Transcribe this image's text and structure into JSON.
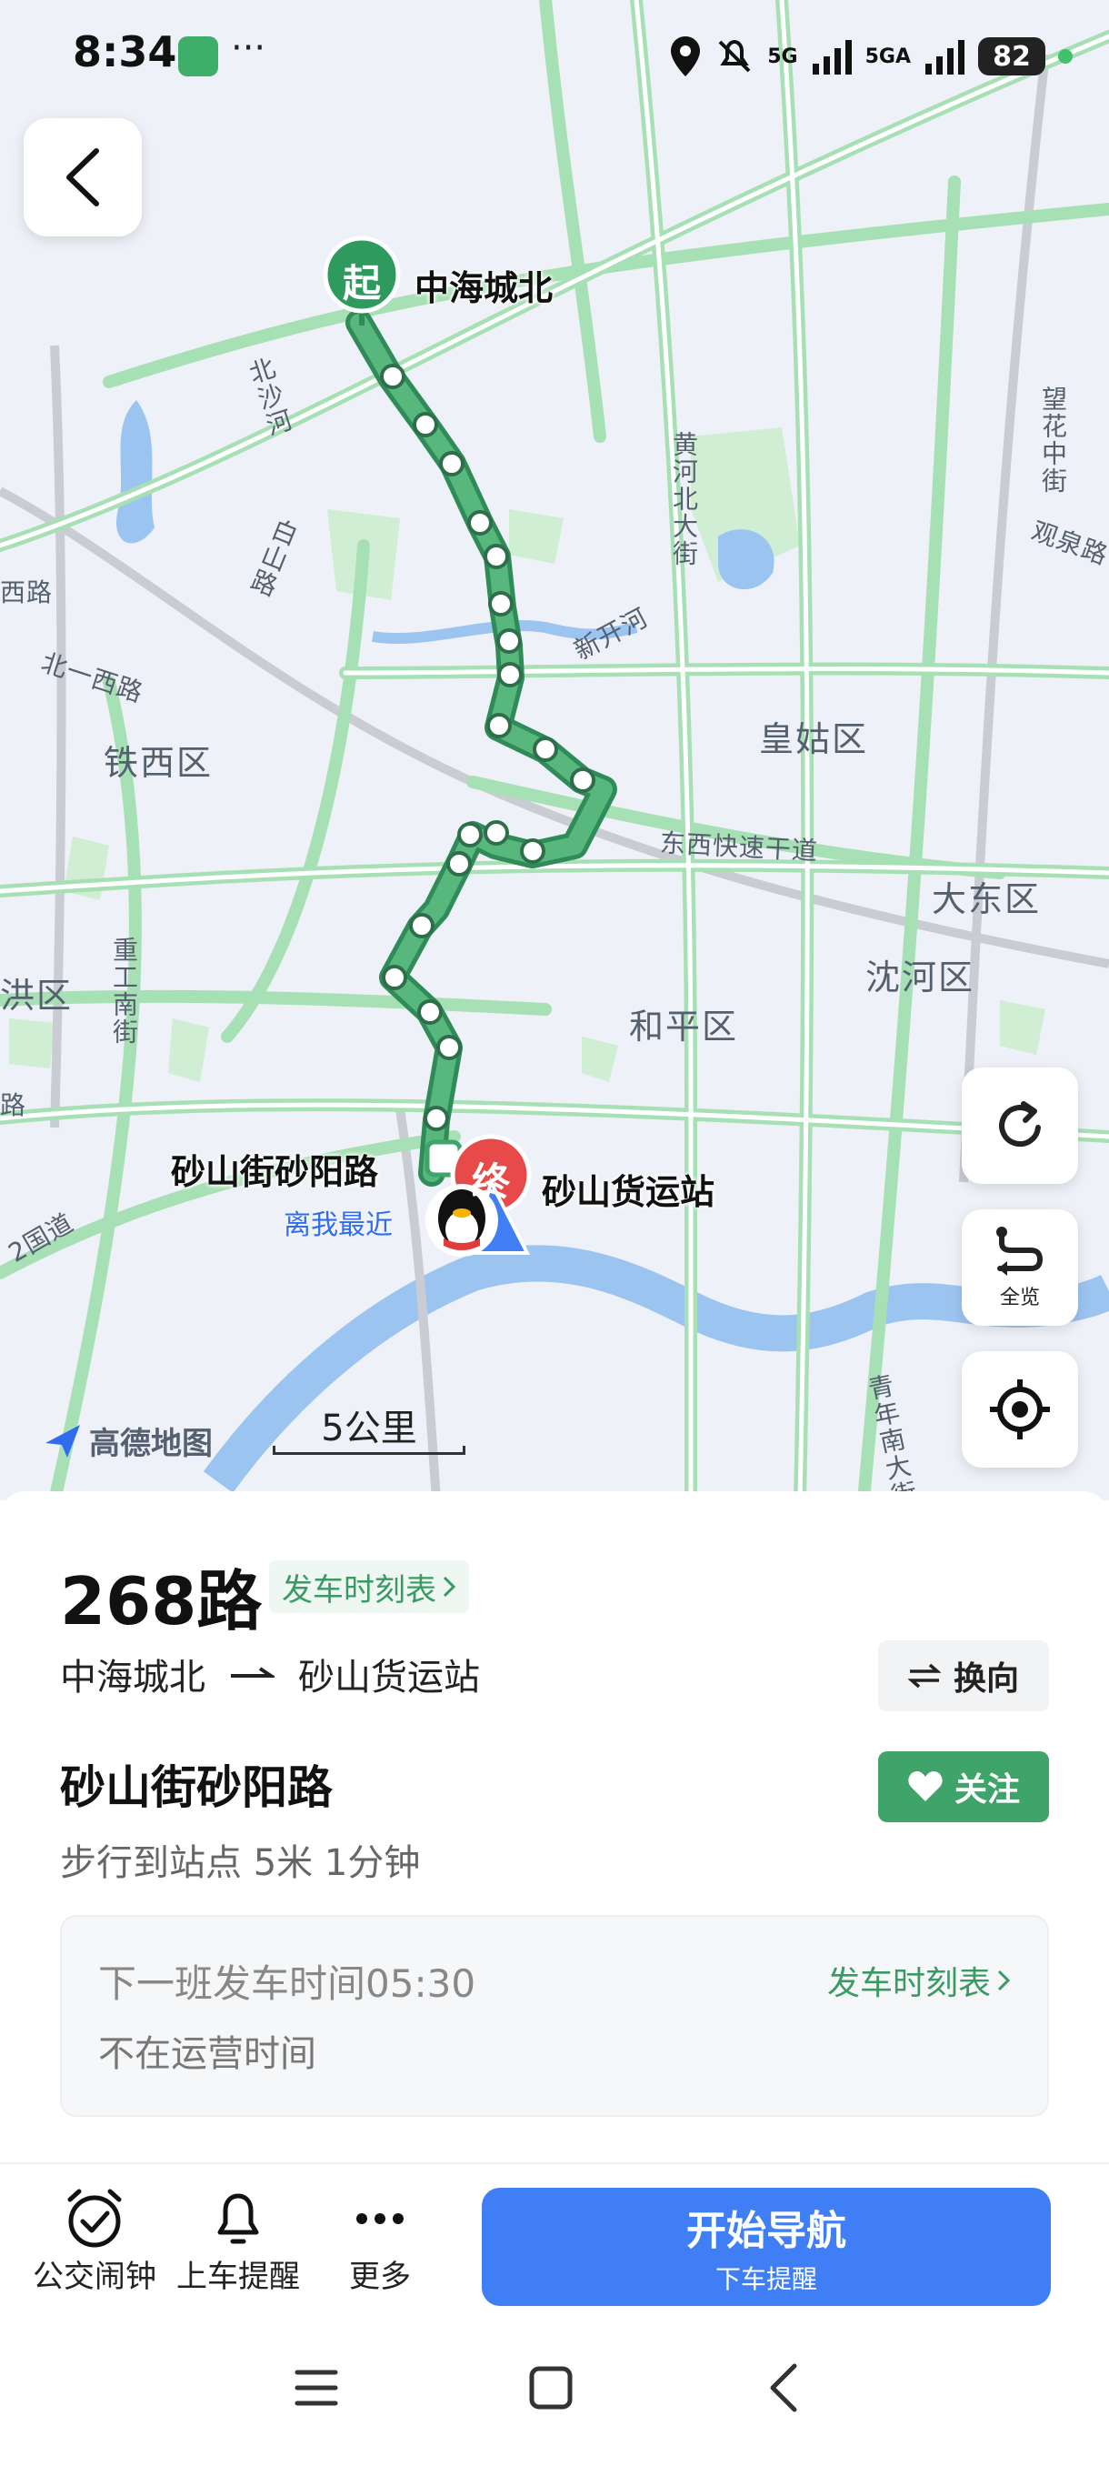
{
  "status_bar": {
    "time": "8:34",
    "more": "···",
    "signal_1": "5G",
    "signal_2": "5GA",
    "battery": "82"
  },
  "map": {
    "district_labels": [
      "铁西区",
      "皇姑区",
      "大东区",
      "沈河区",
      "和平区",
      "洪区"
    ],
    "road_labels": [
      "东西快速干道",
      "北一西路",
      "新开河",
      "北沙河",
      "白山路",
      "黄河北大街",
      "望花中街",
      "观泉路",
      "重工南街",
      "青年南大街",
      "2国道",
      "西路",
      "路"
    ],
    "start_marker": "起",
    "end_marker": "终",
    "start_stop": "中海城北",
    "current_stop": "砂山街砂阳路",
    "end_stop": "砂山货运站",
    "nearest_label": "离我最近",
    "logo": "高德地图",
    "scale": "5公里",
    "overview_label": "全览"
  },
  "route": {
    "name": "268路",
    "timetable_chip": "发车时刻表",
    "from": "中海城北",
    "to": "砂山货运站",
    "swap_label": "换向",
    "stop_name": "砂山街砂阳路",
    "follow_label": "关注",
    "walk_info": "步行到站点 5米 1分钟",
    "next_departure": "下一班发车时间05:30",
    "operating_status": "不在运营时间",
    "card_timetable": "发车时刻表"
  },
  "actions": {
    "alarm": "公交闹钟",
    "reminder": "上车提醒",
    "more": "更多",
    "navigate": "开始导航",
    "navigate_sub": "下车提醒"
  },
  "colors": {
    "route_green": "#3fa46a",
    "nav_blue": "#3f7ef5",
    "end_red": "#e84a4a"
  }
}
